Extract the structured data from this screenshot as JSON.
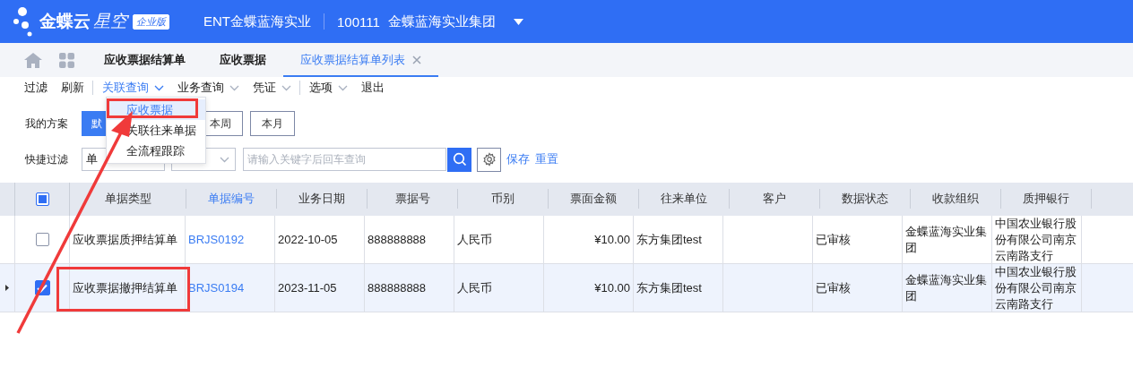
{
  "header": {
    "brand": "金蝶云",
    "product": "星空",
    "edition": "企业版",
    "account": "ENT金蝶蓝海实业",
    "org_code": "100111",
    "org_name": "金蝶蓝海实业集团"
  },
  "tabs": [
    {
      "label": "应收票据结算单",
      "selected": false,
      "closable": false
    },
    {
      "label": "应收票据",
      "selected": false,
      "closable": false
    },
    {
      "label": "应收票据结算单列表",
      "selected": true,
      "closable": true
    }
  ],
  "toolbar": {
    "groups": [
      {
        "items": [
          {
            "label": "过滤",
            "active": false,
            "dropdown": false
          },
          {
            "label": "刷新",
            "active": false,
            "dropdown": false
          }
        ]
      },
      {
        "items": [
          {
            "label": "关联查询",
            "active": true,
            "dropdown": true
          },
          {
            "label": "业务查询",
            "active": false,
            "dropdown": true
          },
          {
            "label": "凭证",
            "active": false,
            "dropdown": true
          }
        ]
      },
      {
        "items": [
          {
            "label": "选项",
            "active": false,
            "dropdown": true
          },
          {
            "label": "退出",
            "active": false,
            "dropdown": false
          }
        ]
      }
    ]
  },
  "menu": {
    "items": [
      {
        "label": "应收票据",
        "selected": true
      },
      {
        "label": "关联往来单据",
        "selected": false
      },
      {
        "label": "全流程跟踪",
        "selected": false
      }
    ]
  },
  "schemes": {
    "label": "我的方案",
    "items": [
      {
        "label": "默",
        "selected": true
      },
      {
        "label": "本周",
        "selected": false
      },
      {
        "label": "本月",
        "selected": false
      }
    ]
  },
  "quick_filter": {
    "label": "快捷过滤",
    "field_value": "单",
    "search_placeholder": "请输入关键字后回车查询",
    "save": "保存",
    "reset": "重置"
  },
  "table": {
    "select_all_partial": true,
    "columns": [
      {
        "label": "单据类型",
        "highlighted": false
      },
      {
        "label": "单据编号",
        "highlighted": true
      },
      {
        "label": "业务日期",
        "highlighted": false
      },
      {
        "label": "票据号",
        "highlighted": false
      },
      {
        "label": "币别",
        "highlighted": false
      },
      {
        "label": "票面金额",
        "highlighted": false,
        "numeric": true
      },
      {
        "label": "往来单位",
        "highlighted": false
      },
      {
        "label": "客户",
        "highlighted": false
      },
      {
        "label": "数据状态",
        "highlighted": false
      },
      {
        "label": "收款组织",
        "highlighted": false
      },
      {
        "label": "质押银行",
        "highlighted": false
      }
    ],
    "rows": [
      {
        "checked": false,
        "selected": false,
        "cells": [
          "应收票据质押结算单",
          "BRJS0192",
          "2022-10-05",
          "888888888",
          "人民币",
          "¥10.00",
          "东方集团test",
          "",
          "已审核",
          "金蝶蓝海实业集团",
          "中国农业银行股份有限公司南京云南路支行"
        ]
      },
      {
        "checked": true,
        "selected": true,
        "cells": [
          "应收票据撤押结算单",
          "BRJS0194",
          "2023-11-05",
          "888888888",
          "人民币",
          "¥10.00",
          "东方集团test",
          "",
          "已审核",
          "金蝶蓝海实业集团",
          "中国农业银行股份有限公司南京云南路支行"
        ]
      }
    ]
  }
}
